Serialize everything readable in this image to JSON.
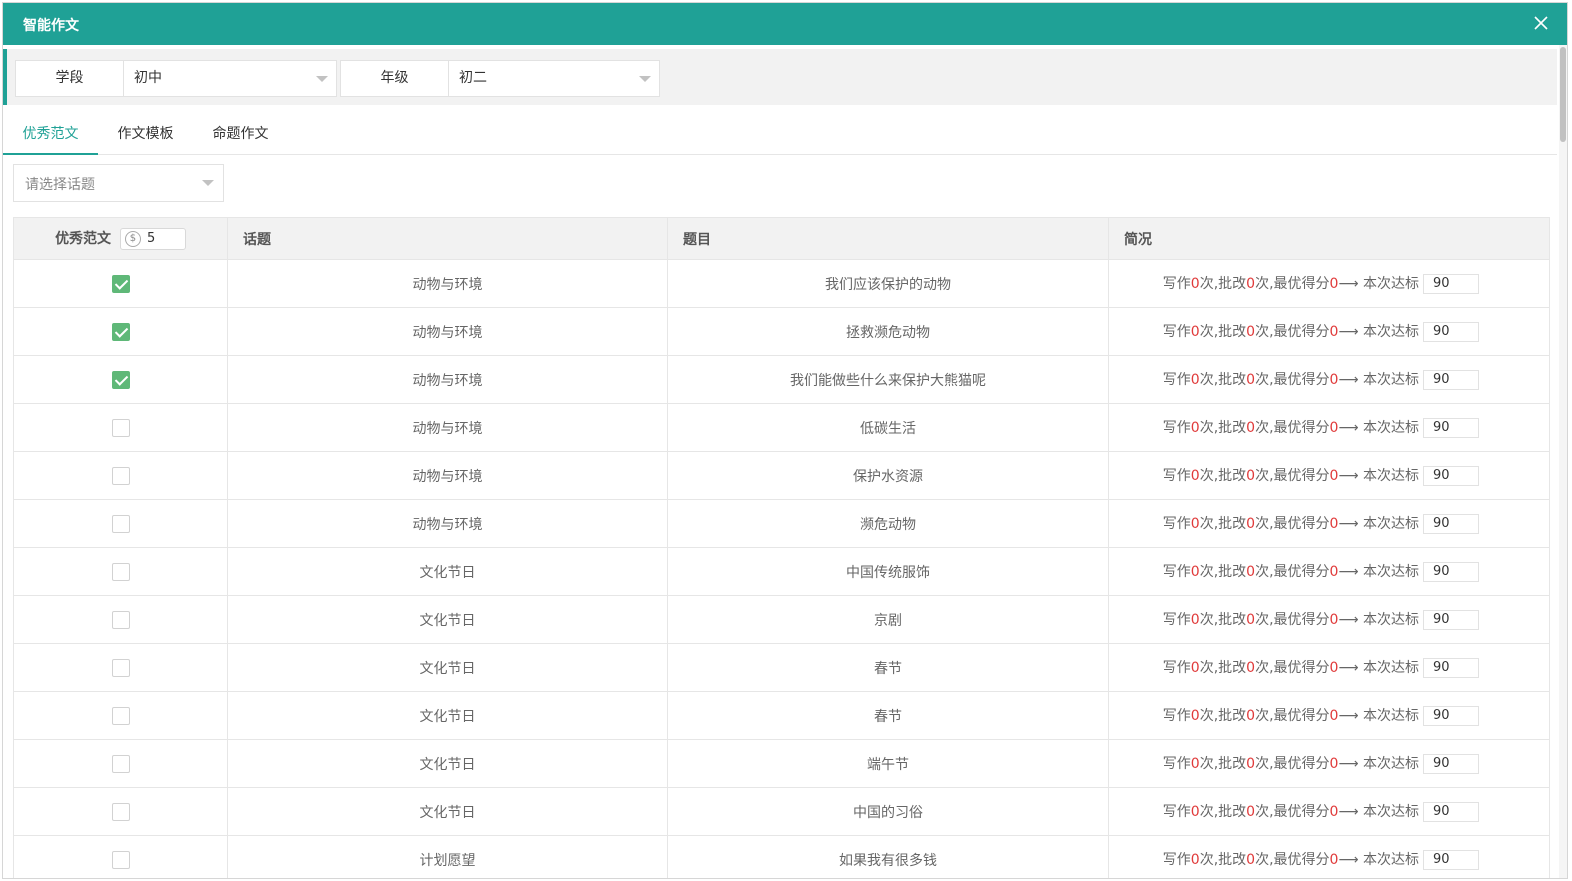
{
  "window": {
    "title": "智能作文"
  },
  "filters": {
    "stage": {
      "label": "学段",
      "value": "初中"
    },
    "grade": {
      "label": "年级",
      "value": "初二"
    }
  },
  "tabs": [
    {
      "label": "优秀范文",
      "active": true
    },
    {
      "label": "作文模板",
      "active": false
    },
    {
      "label": "命题作文",
      "active": false
    }
  ],
  "topic_select": {
    "placeholder": "请选择话题"
  },
  "table": {
    "headers": {
      "select": "优秀范文",
      "coin_value": "5",
      "topic": "话题",
      "title": "题目",
      "summary": "简况"
    },
    "summary_parts": {
      "write": "写作",
      "times": "次",
      "correct": ",批改",
      "best": "次,最优得分",
      "arrow": "⟶ 本次达标"
    },
    "rows": [
      {
        "checked": true,
        "topic": "动物与环境",
        "title": "我们应该保护的动物",
        "write_count": "0",
        "correct_count": "0",
        "best_score": "0",
        "target": "90"
      },
      {
        "checked": true,
        "topic": "动物与环境",
        "title": "拯救濒危动物",
        "write_count": "0",
        "correct_count": "0",
        "best_score": "0",
        "target": "90"
      },
      {
        "checked": true,
        "topic": "动物与环境",
        "title": "我们能做些什么来保护大熊猫呢",
        "write_count": "0",
        "correct_count": "0",
        "best_score": "0",
        "target": "90"
      },
      {
        "checked": false,
        "topic": "动物与环境",
        "title": "低碳生活",
        "write_count": "0",
        "correct_count": "0",
        "best_score": "0",
        "target": "90"
      },
      {
        "checked": false,
        "topic": "动物与环境",
        "title": "保护水资源",
        "write_count": "0",
        "correct_count": "0",
        "best_score": "0",
        "target": "90"
      },
      {
        "checked": false,
        "topic": "动物与环境",
        "title": "濒危动物",
        "write_count": "0",
        "correct_count": "0",
        "best_score": "0",
        "target": "90"
      },
      {
        "checked": false,
        "topic": "文化节日",
        "title": "中国传统服饰",
        "write_count": "0",
        "correct_count": "0",
        "best_score": "0",
        "target": "90"
      },
      {
        "checked": false,
        "topic": "文化节日",
        "title": "京剧",
        "write_count": "0",
        "correct_count": "0",
        "best_score": "0",
        "target": "90"
      },
      {
        "checked": false,
        "topic": "文化节日",
        "title": "春节",
        "write_count": "0",
        "correct_count": "0",
        "best_score": "0",
        "target": "90"
      },
      {
        "checked": false,
        "topic": "文化节日",
        "title": "春节",
        "write_count": "0",
        "correct_count": "0",
        "best_score": "0",
        "target": "90"
      },
      {
        "checked": false,
        "topic": "文化节日",
        "title": "端午节",
        "write_count": "0",
        "correct_count": "0",
        "best_score": "0",
        "target": "90"
      },
      {
        "checked": false,
        "topic": "文化节日",
        "title": "中国的习俗",
        "write_count": "0",
        "correct_count": "0",
        "best_score": "0",
        "target": "90"
      },
      {
        "checked": false,
        "topic": "计划愿望",
        "title": "如果我有很多钱",
        "write_count": "0",
        "correct_count": "0",
        "best_score": "0",
        "target": "90"
      }
    ]
  },
  "colors": {
    "accent": "#1fa196",
    "checkbox_on": "#5fb878",
    "highlight": "#e03a3a"
  }
}
